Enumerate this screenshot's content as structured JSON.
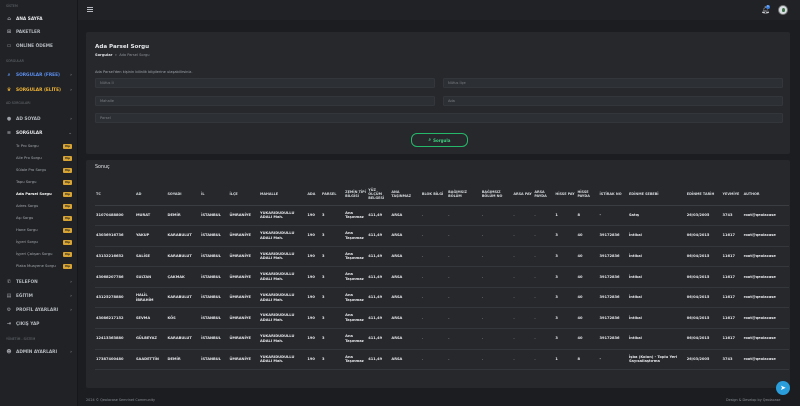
{
  "sidebar": {
    "sections": [
      "SİSTEM",
      "SORGULAR",
      "AD SORGULARI",
      "YÖNETİM - SİSTEM"
    ],
    "items": [
      {
        "label": "ANA SAYFA",
        "icon": "home-icon"
      },
      {
        "label": "PAKETLER",
        "icon": "cart-icon"
      },
      {
        "label": "ONLİNE ÖDEME",
        "icon": "card-icon"
      },
      {
        "label": "SORGULAR (FREE)",
        "icon": "search-icon"
      },
      {
        "label": "SORGULAR (ELİTE)",
        "icon": "crown-icon"
      },
      {
        "label": "AD SOYAD",
        "icon": "user-icon"
      },
      {
        "label": "SORGULAR",
        "icon": "list-icon"
      },
      {
        "label": "TELEFON",
        "icon": "phone-icon"
      },
      {
        "label": "EĞİTİM",
        "icon": "book-icon"
      },
      {
        "label": "PROFİL AYARLARI",
        "icon": "gear-icon"
      },
      {
        "label": "ÇIKIŞ YAP",
        "icon": "logout-icon"
      },
      {
        "label": "ADMİN AYARLARI",
        "icon": "admin-icon"
      }
    ],
    "subitems": [
      {
        "label": "Tc Pro Sorgu",
        "badge": "Vip"
      },
      {
        "label": "Aile Pro Sorgu",
        "badge": "Vip"
      },
      {
        "label": "Sülale Pro Sorgu",
        "badge": "Vip"
      },
      {
        "label": "Tapu Sorgu",
        "badge": "Vip"
      },
      {
        "label": "Ada Parsel Sorgu",
        "badge": "Vip"
      },
      {
        "label": "Adres Sorgu",
        "badge": "Vip"
      },
      {
        "label": "Aşı Sorgu",
        "badge": "Vip"
      },
      {
        "label": "Hane Sorgu",
        "badge": "Vip"
      },
      {
        "label": "İşyeri Sorgu",
        "badge": "Vip"
      },
      {
        "label": "İşyeri Çalışan Sorgu",
        "badge": "Vip"
      },
      {
        "label": "Plaka Muayene Sorgu",
        "badge": "Vip"
      }
    ]
  },
  "topbar": {
    "notification_count": "1"
  },
  "page": {
    "title": "Ada Parsel Sorgu",
    "breadcrumb_root": "Sorgular",
    "breadcrumb_sep": "»",
    "breadcrumb_current": "Ada Parsel Sorgu",
    "description": "Ada Parsel'den kişinin bilinlik bilgilerine ulaşabilirsiniz.",
    "fields": {
      "il_placeholder": "Nüfus İl",
      "ilce_placeholder": "Nüfus İlçe",
      "mahalle_placeholder": "Mahalle",
      "ada_placeholder": "Ada",
      "parsel_placeholder": "Parsel"
    },
    "submit_label": "Sorgula",
    "results_title": "Sonuç"
  },
  "table": {
    "headers": [
      "TC",
      "AD",
      "SOYADI",
      "İL",
      "İLÇE",
      "MAHALLE",
      "ADA",
      "PARSEL",
      "ZEMİN TİPİ BİLGİSİ",
      "YÜZ ÖLÇÜM BELGESİ",
      "ANA TAŞINMAZ",
      "BLOK BİLGİ",
      "BAĞIMSIZ BÖLÜM",
      "BAĞIMSIZ BÖLÜM NO",
      "ARSA PAY",
      "ARSA PAYDA",
      "HİSSE PAY",
      "HİSSE PAYDA",
      "İSTİRAK NO",
      "EDİNME SEBEBİ",
      "EDİNME TARİH",
      "YEVMİYE",
      "AUTHOR"
    ],
    "rows": [
      [
        "31070488800",
        "MURAT",
        "DEMİR",
        "İSTANBUL",
        "ÜMRANİYE",
        "YUKARIDUDULLU ADALI Mah.",
        "190",
        "3",
        "Ana Taşınmaz",
        "411,49",
        "ARSA",
        "-",
        "-",
        "-",
        "-",
        "-",
        "1",
        "8",
        "-",
        "Satış",
        "26/03/2005",
        "3743",
        "root@qeolacase"
      ],
      [
        "43036916736",
        "YAKUP",
        "KARABULUT",
        "İSTANBUL",
        "ÜMRANİYE",
        "YUKARIDUDULLU ADALI Mah.",
        "190",
        "3",
        "Ana Taşınmaz",
        "411,49",
        "ARSA",
        "-",
        "-",
        "-",
        "-",
        "-",
        "3",
        "40",
        "39172836",
        "İntikal",
        "06/04/2015",
        "11617",
        "root@qeolacase"
      ],
      [
        "43132216652",
        "SALİSE",
        "KARABULUT",
        "İSTANBUL",
        "ÜMRANİYE",
        "YUKARIDUDULLU ADALI Mah.",
        "190",
        "3",
        "Ana Taşınmaz",
        "411,49",
        "ARSA",
        "-",
        "-",
        "-",
        "-",
        "-",
        "3",
        "40",
        "39172836",
        "İntikal",
        "06/04/2015",
        "11617",
        "root@qeolacase"
      ],
      [
        "43068207786",
        "SULTAN",
        "ÇAKMAK",
        "İSTANBUL",
        "ÜMRANİYE",
        "YUKARIDUDULLU ADALI Mah.",
        "190",
        "3",
        "Ana Taşınmaz",
        "411,49",
        "ARSA",
        "-",
        "-",
        "-",
        "-",
        "-",
        "3",
        "40",
        "39172836",
        "İntikal",
        "06/04/2015",
        "11617",
        "root@qeolacase"
      ],
      [
        "43125278880",
        "HALİL İBRAHİM",
        "KARABULUT",
        "İSTANBUL",
        "ÜMRANİYE",
        "YUKARIDUDULLU ADALI Mah.",
        "190",
        "3",
        "Ana Taşınmaz",
        "411,49",
        "ARSA",
        "-",
        "-",
        "-",
        "-",
        "-",
        "3",
        "40",
        "39172836",
        "İntikal",
        "06/04/2015",
        "11617",
        "root@qeolacase"
      ],
      [
        "43086217152",
        "SEVMA",
        "KÖS",
        "İSTANBUL",
        "ÜMRANİYE",
        "YUKARIDUDULLU ADALI Mah.",
        "190",
        "3",
        "Ana Taşınmaz",
        "411,49",
        "ARSA",
        "-",
        "-",
        "-",
        "-",
        "-",
        "3",
        "40",
        "39172836",
        "İntikal",
        "06/04/2015",
        "11617",
        "root@qeolacase"
      ],
      [
        "12413363880",
        "GÜLBEYAZ",
        "KARABULUT",
        "İSTANBUL",
        "ÜMRANİYE",
        "YUKARIDUDULLU ADALI Mah.",
        "190",
        "3",
        "Ana Taşınmaz",
        "411,49",
        "ARSA",
        "-",
        "-",
        "-",
        "-",
        "-",
        "3",
        "40",
        "39172836",
        "İntikal",
        "06/04/2015",
        "11617",
        "root@qeolacase"
      ],
      [
        "17387400480",
        "SAADETTİN",
        "DEMİR",
        "İSTANBUL",
        "ÜMRANİYE",
        "YUKARIDUDULLU ADALI Mah.",
        "190",
        "3",
        "Ana Taşınmaz",
        "411,49",
        "ARSA",
        "-",
        "-",
        "-",
        "-",
        "-",
        "1",
        "8",
        "-",
        "İşba (Kolon) - Toplu Yeri Sayısallaştırma",
        "26/03/2005",
        "3743",
        "root@qeolacase"
      ]
    ]
  },
  "footer": {
    "left": "2024 © Qeolacase Semrinet Community",
    "right": "Design & Develop by Qeolacase"
  },
  "colors": {
    "accent": "#f1b536",
    "success": "#26b86a",
    "background": "#1b1d20",
    "panel": "#26282c"
  }
}
